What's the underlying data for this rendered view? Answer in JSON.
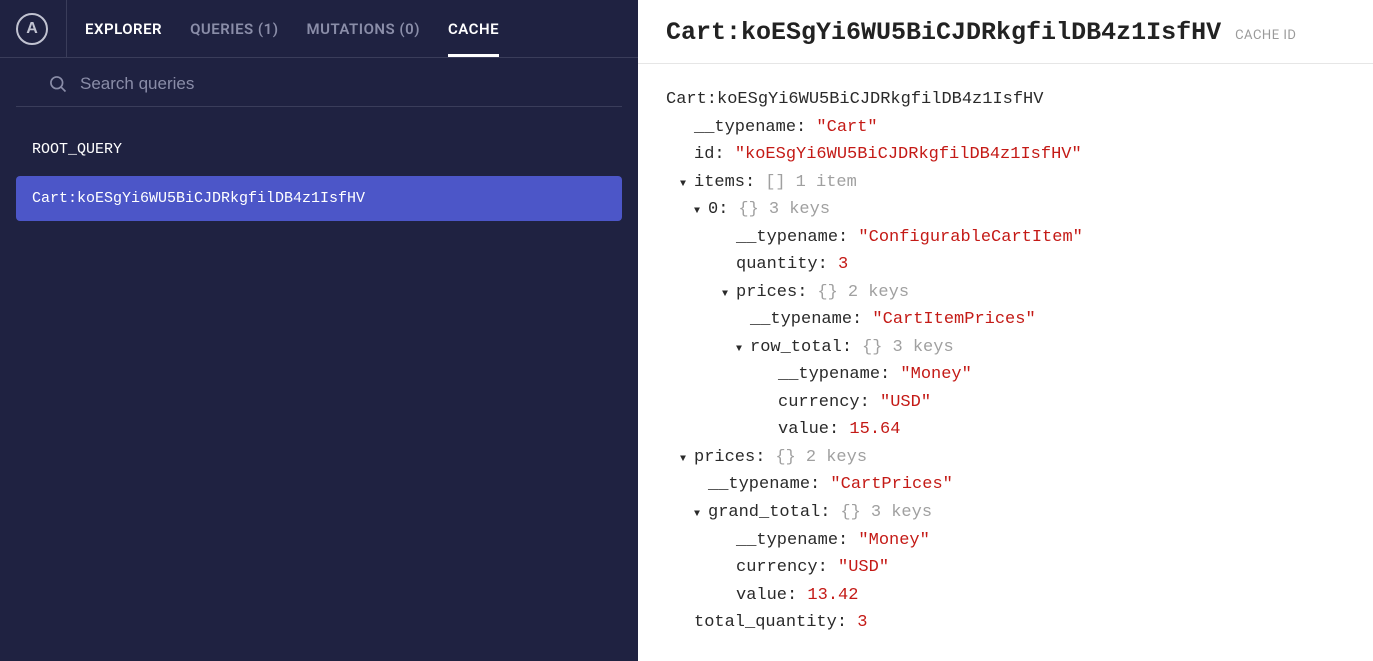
{
  "nav": {
    "explorer": "EXPLORER",
    "queries": "QUERIES (1)",
    "mutations": "MUTATIONS (0)",
    "cache": "CACHE"
  },
  "search": {
    "placeholder": "Search queries"
  },
  "cache_list": {
    "root_query": "ROOT_QUERY",
    "selected": "Cart:koESgYi6WU5BiCJDRkgfilDB4z1IsfHV"
  },
  "header": {
    "title": "Cart:koESgYi6WU5BiCJDRkgfilDB4z1IsfHV",
    "label": "CACHE ID"
  },
  "tree": {
    "root": "Cart:koESgYi6WU5BiCJDRkgfilDB4z1IsfHV",
    "typename_key": "__typename:",
    "typename_val": "\"Cart\"",
    "id_key": "id:",
    "id_val": "\"koESgYi6WU5BiCJDRkgfilDB4z1IsfHV\"",
    "items_key": "items:",
    "items_brackets": "[]",
    "items_meta": "1 item",
    "idx0_key": "0:",
    "braces": "{}",
    "keys3": "3 keys",
    "keys2": "2 keys",
    "cfg_typename_val": "\"ConfigurableCartItem\"",
    "quantity_key": "quantity:",
    "quantity_val": "3",
    "prices_key": "prices:",
    "cip_typename_val": "\"CartItemPrices\"",
    "row_total_key": "row_total:",
    "money_typename_val": "\"Money\"",
    "currency_key": "currency:",
    "currency_val": "\"USD\"",
    "value_key": "value:",
    "row_total_value": "15.64",
    "cp_typename_val": "\"CartPrices\"",
    "grand_total_key": "grand_total:",
    "grand_total_value": "13.42",
    "total_qty_key": "total_quantity:",
    "total_qty_val": "3"
  }
}
